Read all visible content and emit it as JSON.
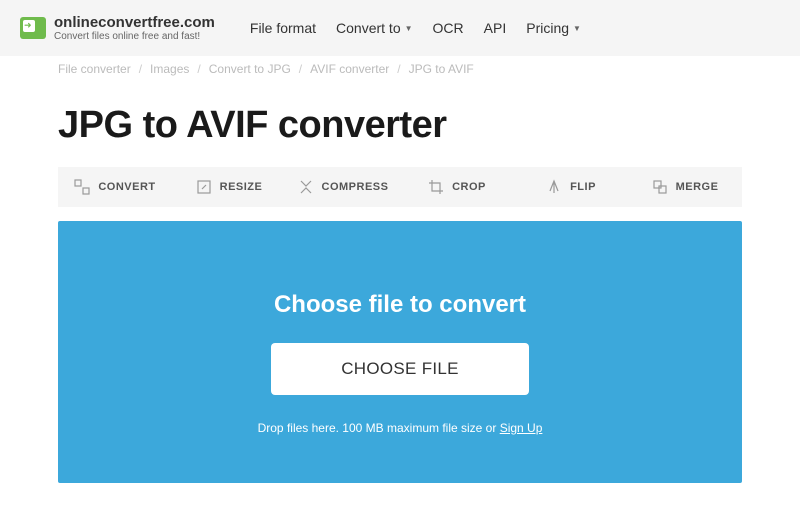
{
  "header": {
    "logo_name": "onlineconvertfree.com",
    "logo_tagline": "Convert files online free and fast!"
  },
  "nav": {
    "items": [
      {
        "label": "File format",
        "dropdown": false
      },
      {
        "label": "Convert to",
        "dropdown": true
      },
      {
        "label": "OCR",
        "dropdown": false
      },
      {
        "label": "API",
        "dropdown": false
      },
      {
        "label": "Pricing",
        "dropdown": true
      }
    ]
  },
  "breadcrumb": {
    "items": [
      "File converter",
      "Images",
      "Convert to JPG",
      "AVIF converter",
      "JPG to AVIF"
    ]
  },
  "page": {
    "title": "JPG to AVIF converter"
  },
  "tools": {
    "items": [
      {
        "label": "CONVERT"
      },
      {
        "label": "RESIZE"
      },
      {
        "label": "COMPRESS"
      },
      {
        "label": "CROP"
      },
      {
        "label": "FLIP"
      },
      {
        "label": "MERGE"
      }
    ]
  },
  "upload": {
    "title": "Choose file to convert",
    "button_label": "CHOOSE FILE",
    "hint_prefix": "Drop files here. 100 MB maximum file size or ",
    "hint_link": "Sign Up"
  }
}
